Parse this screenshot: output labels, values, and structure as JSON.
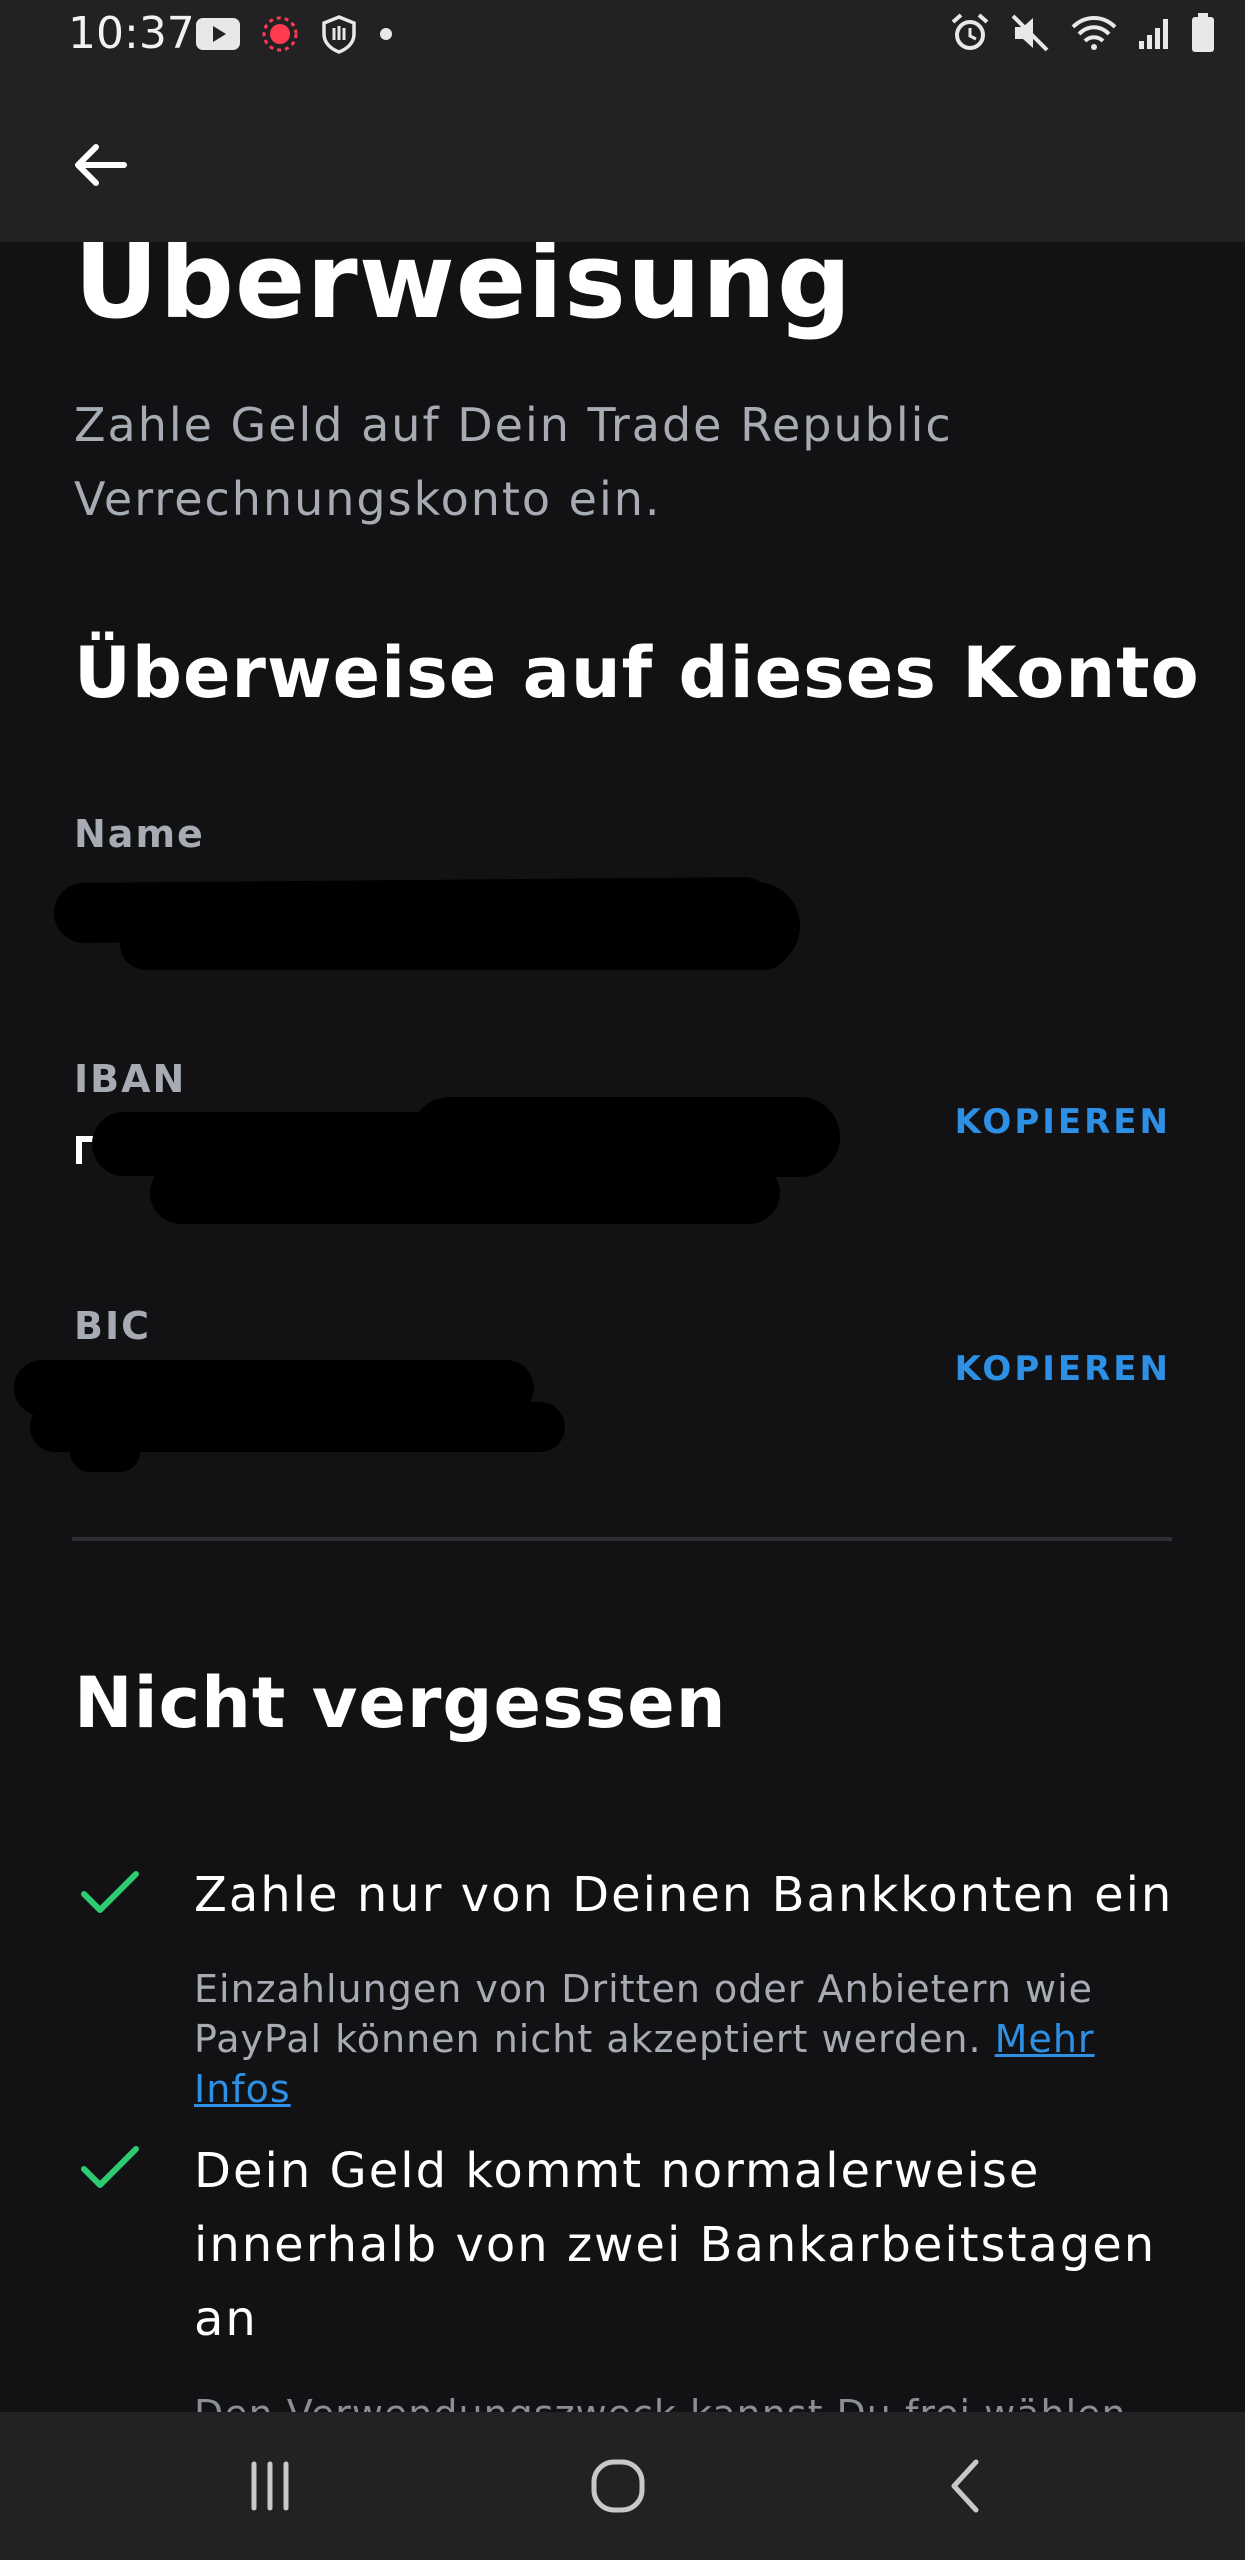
{
  "status_bar": {
    "time": "10:37",
    "left_icons": [
      "youtube-icon",
      "record-icon",
      "shield-icon",
      "dot-icon"
    ],
    "right_icons": [
      "alarm-icon",
      "mute-icon",
      "wifi-icon",
      "signal-icon",
      "battery-icon"
    ]
  },
  "app_bar": {
    "back_icon": "arrow-left-icon"
  },
  "header": {
    "title": "Überweisung",
    "subtitle": "Zahle Geld auf Dein Trade Republic Verrechnungskonto ein."
  },
  "account": {
    "heading": "Überweise auf dieses Konto",
    "fields": [
      {
        "label": "Name",
        "value": "",
        "copy": ""
      },
      {
        "label": "IBAN",
        "value": "",
        "copy": "KOPIEREN"
      },
      {
        "label": "BIC",
        "value": "",
        "copy": "KOPIEREN"
      }
    ]
  },
  "reminders": {
    "heading": "Nicht vergessen",
    "items": [
      {
        "title": "Zahle nur von Deinen Bankkonten ein",
        "desc": "Einzahlungen von Dritten oder Anbietern wie PayPal können nicht akzeptiert werden.",
        "link": "Mehr Infos"
      },
      {
        "title": "Dein Geld kommt normalerweise innerhalb von zwei Bankarbeitstagen an",
        "desc": "Den Verwendungszweck kannst Du frei wählen"
      }
    ],
    "check_color": "#2ecc71"
  },
  "nav_bar": {
    "icons": [
      "recents-icon",
      "home-icon",
      "back-icon"
    ]
  },
  "colors": {
    "accent": "#2e90e5",
    "background": "#121214",
    "bar": "#222224"
  }
}
